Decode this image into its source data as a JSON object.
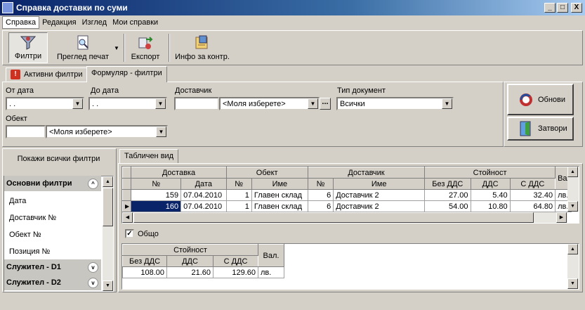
{
  "window": {
    "title": "Справка доставки по суми",
    "min": "_",
    "max": "□",
    "close": "X"
  },
  "menu": [
    "Справка",
    "Редакция",
    "Изглед",
    "Мои справки"
  ],
  "toolbar": {
    "filters": "Филтри",
    "preview": "Преглед печат",
    "export": "Експорт",
    "info": "Инфо за контр."
  },
  "tabs": {
    "active_filters": "Активни филтри",
    "form_filters": "Формуляр - филтри",
    "alert": "!"
  },
  "form": {
    "from_date_label": "От дата",
    "from_date_value": " .  .",
    "to_date_label": "До дата",
    "to_date_value": " .  .",
    "supplier_label": "Доставчик",
    "supplier_value": "<Моля изберете>",
    "doctype_label": "Тип документ",
    "doctype_value": "Всички",
    "object_label": "Обект",
    "object_value": "<Моля изберете>",
    "ellipsis": "..."
  },
  "buttons": {
    "refresh": "Обнови",
    "close": "Затвори"
  },
  "filters_panel": {
    "show_all": "Покажи всички филтри",
    "main_group": "Основни филтри",
    "items": [
      "Дата",
      "Доставчик №",
      "Обект №",
      "Позиция №"
    ],
    "group2": "Служител - D1",
    "group3": "Служител - D2"
  },
  "grid_tab": "Табличен вид",
  "grid": {
    "groups": [
      "Доставка",
      "Обект",
      "Доставчик",
      "Стойност",
      "Вал."
    ],
    "columns": [
      "№",
      "Дата",
      "№",
      "Име",
      "№",
      "Име",
      "Без ДДС",
      "ДДС",
      "С ДДС"
    ],
    "rows": [
      [
        "159",
        "07.04.2010",
        "1",
        "Главен склад",
        "6",
        "Доставчик 2",
        "27.00",
        "5.40",
        "32.40",
        "лв."
      ],
      [
        "160",
        "07.04.2010",
        "1",
        "Главен склад",
        "6",
        "Доставчик 2",
        "54.00",
        "10.80",
        "64.80",
        "лв."
      ]
    ]
  },
  "total": {
    "checkbox_label": "Общо",
    "group": "Стойност",
    "currency_header": "Вал.",
    "columns": [
      "Без ДДС",
      "ДДС",
      "С ДДС"
    ],
    "values": [
      "108.00",
      "21.60",
      "129.60",
      "лв."
    ]
  }
}
